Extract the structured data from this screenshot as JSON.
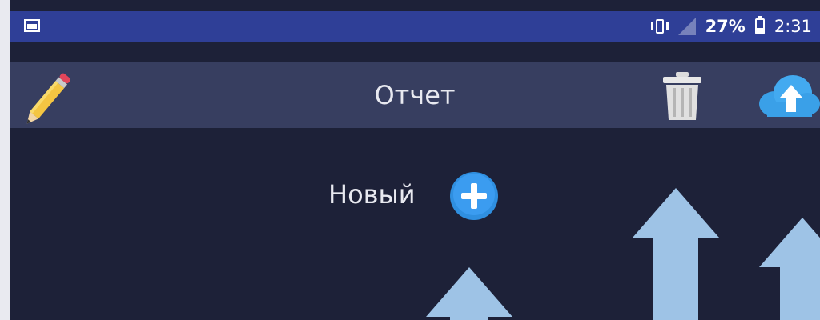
{
  "status_bar": {
    "battery_percent": "27%",
    "time": "2:31",
    "icons": [
      "image-icon",
      "vibrate-icon",
      "signal-icon",
      "battery-icon"
    ]
  },
  "toolbar": {
    "title": "Отчет",
    "icons": [
      "pencil-icon",
      "trash-icon",
      "cloud-upload-icon"
    ]
  },
  "main": {
    "new_label": "Новый",
    "add_icon": "plus-circle-icon"
  },
  "colors": {
    "background": "#1d2138",
    "status_bar": "#2f3f97",
    "toolbar": "#373e60",
    "arrows": "#9ec3e6",
    "plus_button": "#2f8fe0"
  }
}
